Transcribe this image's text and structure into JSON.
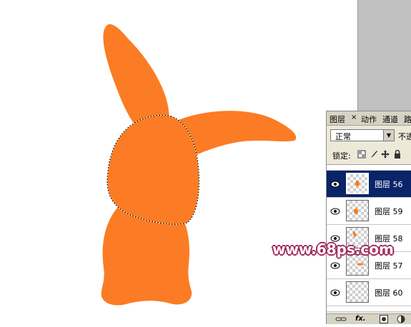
{
  "colors": {
    "shape_fill": "#fb7c24",
    "canvas_bg": "#ffffff",
    "workspace_gray": "#c0c0c0",
    "selected_row": "#0a246a",
    "watermark_outline": "#a0285a"
  },
  "layers_panel": {
    "tabs": [
      {
        "label": "图层",
        "active": true
      },
      {
        "label": "动作",
        "active": false
      },
      {
        "label": "通道",
        "active": false
      },
      {
        "label": "路",
        "active": false
      }
    ],
    "close_glyph": "×",
    "blend_mode": "正常",
    "opacity_label": "不透",
    "lock_label": "锁定:",
    "layers": [
      {
        "name": "图层 56",
        "visible": true,
        "selected": true
      },
      {
        "name": "图层 59",
        "visible": true,
        "selected": false
      },
      {
        "name": "图层 58",
        "visible": true,
        "selected": false
      },
      {
        "name": "图层 57",
        "visible": true,
        "selected": false
      },
      {
        "name": "图层 60",
        "visible": true,
        "selected": false
      }
    ],
    "bottom_icons": [
      "link-icon",
      "fx-icon",
      "mask-icon",
      "adjustment-icon"
    ],
    "fx_label": "fx."
  },
  "watermark": "www.68ps.com"
}
